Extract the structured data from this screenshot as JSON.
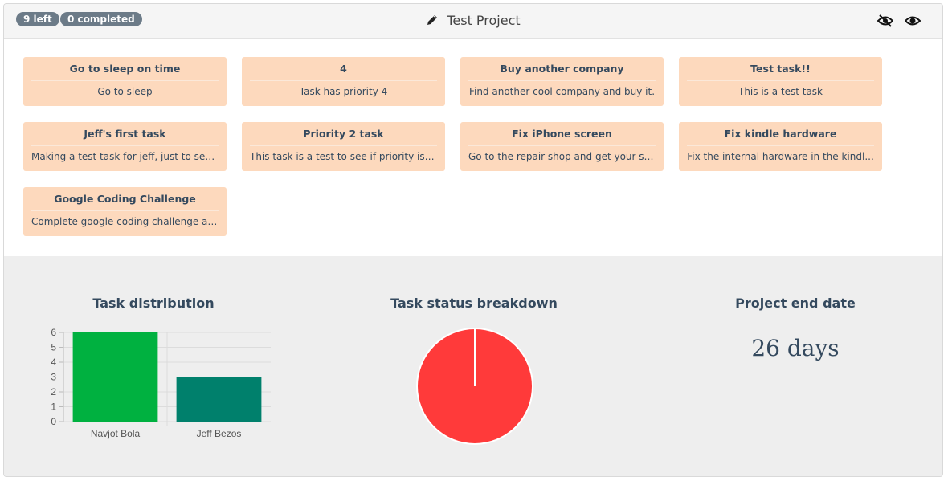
{
  "header": {
    "left_badge": "9 left",
    "completed_badge": "0 completed",
    "project_title": "Test Project"
  },
  "icons": {
    "edit": "pencil-icon",
    "hide": "eye-slash-icon",
    "show": "eye-icon"
  },
  "tasks": [
    {
      "title": "Go to sleep on time",
      "description": "Go to sleep"
    },
    {
      "title": "4",
      "description": "Task has priority 4"
    },
    {
      "title": "Buy another company",
      "description": "Find another cool company and buy it."
    },
    {
      "title": "Test task!!",
      "description": "This is a test task"
    },
    {
      "title": "Jeff's first task",
      "description": "Making a test task for jeff, just to see i..."
    },
    {
      "title": "Priority 2 task",
      "description": "This task is a test to see if priority is s..."
    },
    {
      "title": "Fix iPhone screen",
      "description": "Go to the repair shop and get your scr..."
    },
    {
      "title": "Fix kindle hardware",
      "description": "Fix the internal hardware in the kindl..."
    },
    {
      "title": "Google Coding Challenge",
      "description": "Complete google coding challenge again"
    }
  ],
  "stats": {
    "distribution_title": "Task distribution",
    "status_title": "Task status breakdown",
    "end_date_title": "Project end date",
    "end_date_value": "26 days"
  },
  "colors": {
    "card_bg": "#fdd9bd",
    "bar1": "#00b140",
    "bar2": "#00806c",
    "pie": "#ff3a3a"
  },
  "chart_data": [
    {
      "type": "bar",
      "title": "Task distribution",
      "categories": [
        "Navjot Bola",
        "Jeff Bezos"
      ],
      "values": [
        6,
        3
      ],
      "ylim": [
        0,
        6
      ],
      "yticks": [
        0,
        1,
        2,
        3,
        4,
        5,
        6
      ],
      "grid": true
    },
    {
      "type": "pie",
      "title": "Task status breakdown",
      "values": [
        1
      ]
    }
  ]
}
